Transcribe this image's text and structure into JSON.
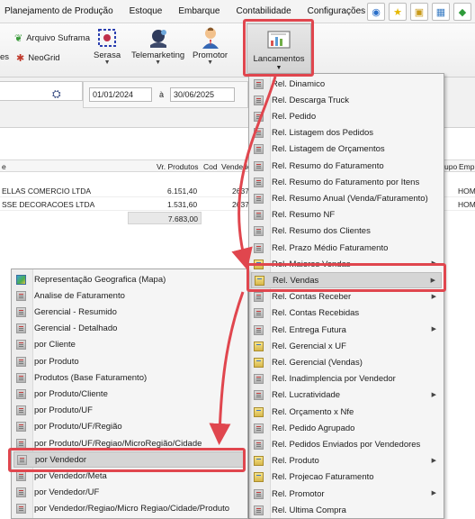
{
  "menubar": {
    "items": [
      "Planejamento de Produção",
      "Estoque",
      "Embarque",
      "Contabilidade",
      "Configurações"
    ]
  },
  "ribbon": {
    "arquivo_suframa": "Arquivo Suframa",
    "neogrid": "NeoGrid",
    "cut_left": "es",
    "serasa": "Serasa",
    "telemarketing": "Telemarketing",
    "promotor": "Promotor",
    "lancamentos": "Lancamentos"
  },
  "filter": {
    "date_from": "01/01/2024",
    "date_sep": "à",
    "date_to": "30/06/2025"
  },
  "grid": {
    "headers": {
      "col_e": "e",
      "vr_produtos": "Vr. Produtos",
      "cod": "Cod",
      "vendedor": "Vendedor",
      "grupo": "upo",
      "emp": "Emp"
    },
    "rows": [
      {
        "cliente": "ELLAS COMERCIO LTDA",
        "valor": "6.151,40",
        "cod": "2637",
        "emp": "HOM"
      },
      {
        "cliente": "SSE DECORACOES LTDA",
        "valor": "1.531,60",
        "cod": "2637",
        "emp": "HOM"
      }
    ],
    "total": "7.683,00"
  },
  "lancamentos_menu": {
    "items": [
      {
        "label": "Rel. Dinamico",
        "submenu": false
      },
      {
        "label": "Rel. Descarga Truck",
        "submenu": false
      },
      {
        "label": "Rel. Pedido",
        "submenu": false
      },
      {
        "label": "Rel. Listagem dos Pedidos",
        "submenu": false
      },
      {
        "label": "Rel. Listagem de Orçamentos",
        "submenu": false
      },
      {
        "label": "Rel. Resumo do Faturamento",
        "submenu": false
      },
      {
        "label": "Rel. Resumo do Faturamento por Itens",
        "submenu": false
      },
      {
        "label": "Rel. Resumo Anual (Venda/Faturamento)",
        "submenu": false
      },
      {
        "label": "Rel. Resumo NF",
        "submenu": false
      },
      {
        "label": "Rel. Resumo dos Clientes",
        "submenu": false
      },
      {
        "label": "Rel. Prazo Médio Faturamento",
        "submenu": false
      },
      {
        "label": "Rel. Maiores Vendas",
        "submenu": true
      },
      {
        "label": "Rel. Vendas",
        "submenu": true
      },
      {
        "label": "Rel. Contas Receber",
        "submenu": true
      },
      {
        "label": "Rel. Contas Recebidas",
        "submenu": false
      },
      {
        "label": "Rel. Entrega Futura",
        "submenu": true
      },
      {
        "label": "Rel. Gerencial x UF",
        "submenu": false
      },
      {
        "label": "Rel. Gerencial (Vendas)",
        "submenu": false
      },
      {
        "label": "Rel. Inadimplencia por Vendedor",
        "submenu": false
      },
      {
        "label": "Rel. Lucratividade",
        "submenu": true
      },
      {
        "label": "Rel. Orçamento x Nfe",
        "submenu": false
      },
      {
        "label": "Rel. Pedido Agrupado",
        "submenu": false
      },
      {
        "label": "Rel. Pedidos Enviados por Vendedores",
        "submenu": false
      },
      {
        "label": "Rel. Produto",
        "submenu": true
      },
      {
        "label": "Rel. Projecao Faturamento",
        "submenu": false
      },
      {
        "label": "Rel. Promotor",
        "submenu": true
      },
      {
        "label": "Rel. Ultima Compra",
        "submenu": false
      }
    ]
  },
  "vendas_submenu": {
    "items": [
      {
        "label": "Representação Geografica (Mapa)"
      },
      {
        "label": "Analise de Faturamento"
      },
      {
        "label": "Gerencial - Resumido"
      },
      {
        "label": "Gerencial - Detalhado"
      },
      {
        "label": "por Cliente"
      },
      {
        "label": "por Produto"
      },
      {
        "label": "Produtos (Base Faturamento)"
      },
      {
        "label": "por Produto/Cliente"
      },
      {
        "label": "por Produto/UF"
      },
      {
        "label": "por Produto/UF/Região"
      },
      {
        "label": "por Produto/UF/Regiao/MicroRegião/Cidade"
      },
      {
        "label": "por Vendedor"
      },
      {
        "label": "por Vendedor/Meta"
      },
      {
        "label": "por Vendedor/UF"
      },
      {
        "label": "por Vendedor/Regiao/Micro Regiao/Cidade/Produto"
      }
    ]
  },
  "colors": {
    "highlight_red": "#e0464e",
    "menu_bg": "#f5f5f5",
    "menu_highlight": "#d5d5d5"
  }
}
